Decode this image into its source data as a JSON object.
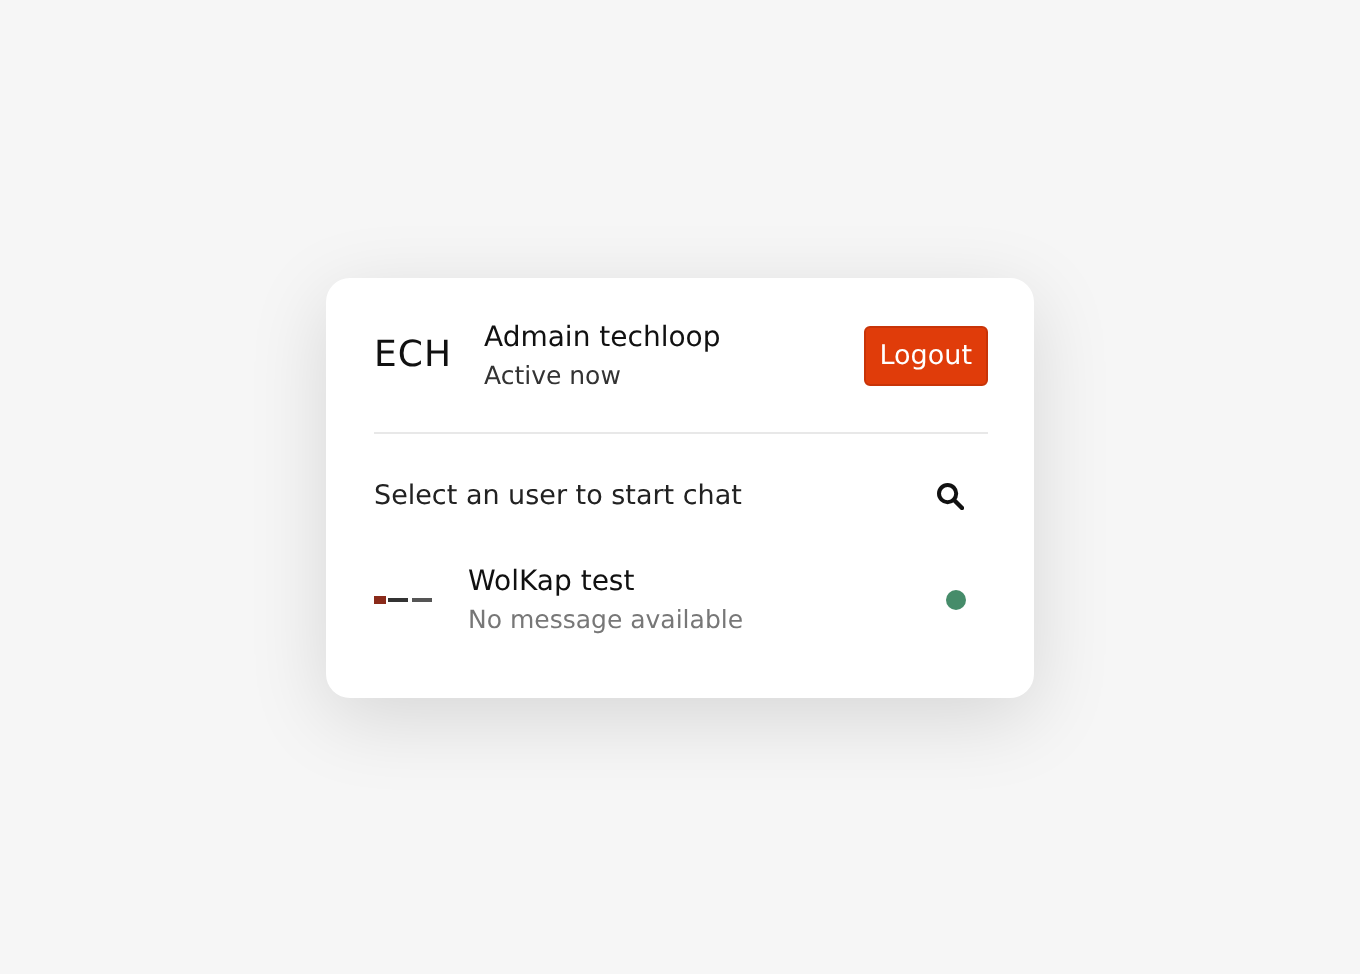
{
  "header": {
    "logo": "ECH",
    "name": "Admain techloop",
    "status": "Active now",
    "logout": "Logout"
  },
  "search": {
    "label": "Select an user to start chat"
  },
  "users": [
    {
      "name": "WolKap test",
      "message": "No message available",
      "online": true,
      "color": "#468c6a"
    }
  ]
}
